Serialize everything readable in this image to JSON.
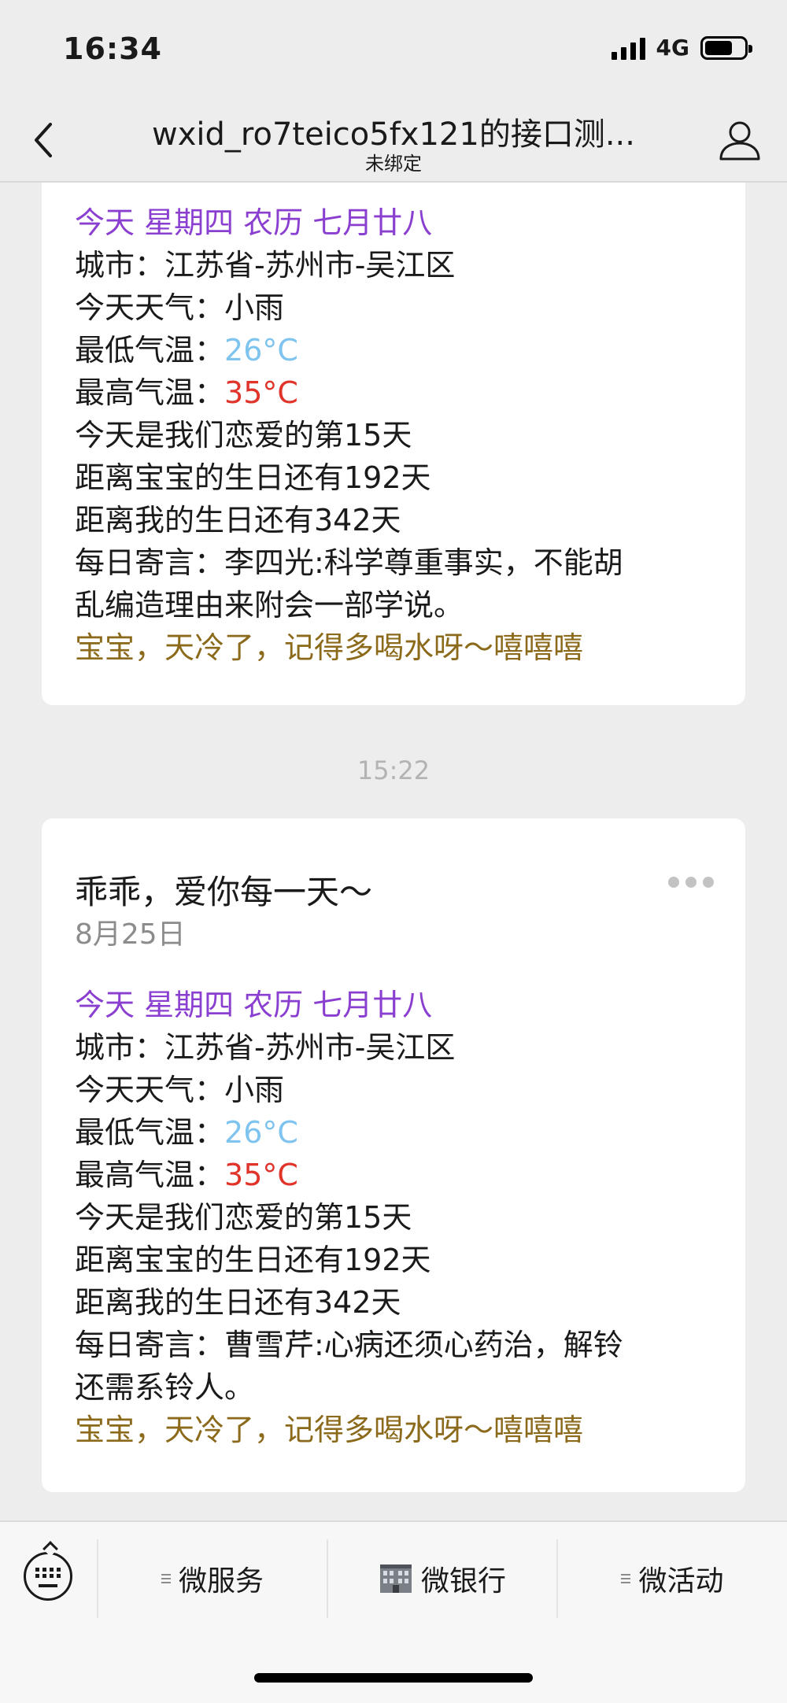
{
  "status_bar": {
    "time": "16:34",
    "network": "4G"
  },
  "nav": {
    "title": "wxid_ro7teico5fx121的接口测...",
    "subtitle": "未绑定"
  },
  "card1": {
    "lines": {
      "date_line": "今天 星期四 农历 七月廿八",
      "city": "城市：江苏省-苏州市-吴江区",
      "weather": "今天天气：小雨",
      "low_label": "最低气温：",
      "low_value": "26°C",
      "high_label": "最高气温：",
      "high_value": "35°C",
      "love_days": "今天是我们恋爱的第15天",
      "baby_bday": "距离宝宝的生日还有192天",
      "my_bday": "距离我的生日还有342天",
      "quote_1": "每日寄言：李四光:科学尊重事实，不能胡",
      "quote_2": "乱编造理由来附会一部学说。",
      "reminder": "宝宝，天冷了，记得多喝水呀～嘻嘻嘻"
    }
  },
  "timestamp": "15:22",
  "card2": {
    "title": "乖乖，爱你每一天～",
    "date": "8月25日",
    "lines": {
      "date_line": "今天 星期四 农历 七月廿八",
      "city": "城市：江苏省-苏州市-吴江区",
      "weather": "今天天气：小雨",
      "low_label": "最低气温：",
      "low_value": "26°C",
      "high_label": "最高气温：",
      "high_value": "35°C",
      "love_days": "今天是我们恋爱的第15天",
      "baby_bday": "距离宝宝的生日还有192天",
      "my_bday": "距离我的生日还有342天",
      "quote_1": "每日寄言：曹雪芹:心病还须心药治，解铃",
      "quote_2": "还需系铃人。",
      "reminder": "宝宝，天冷了，记得多喝水呀～嘻嘻嘻"
    }
  },
  "menu": {
    "items": [
      {
        "label": "微服务",
        "icon": "menu-lines-icon"
      },
      {
        "label": "微银行",
        "icon": "bank-building-icon"
      },
      {
        "label": "微活动",
        "icon": "menu-lines-icon"
      }
    ]
  },
  "colors": {
    "date_line": "#8a3fd1",
    "low_temp": "#7ec4ef",
    "high_temp": "#e0332a",
    "reminder": "#8b6a1b"
  }
}
